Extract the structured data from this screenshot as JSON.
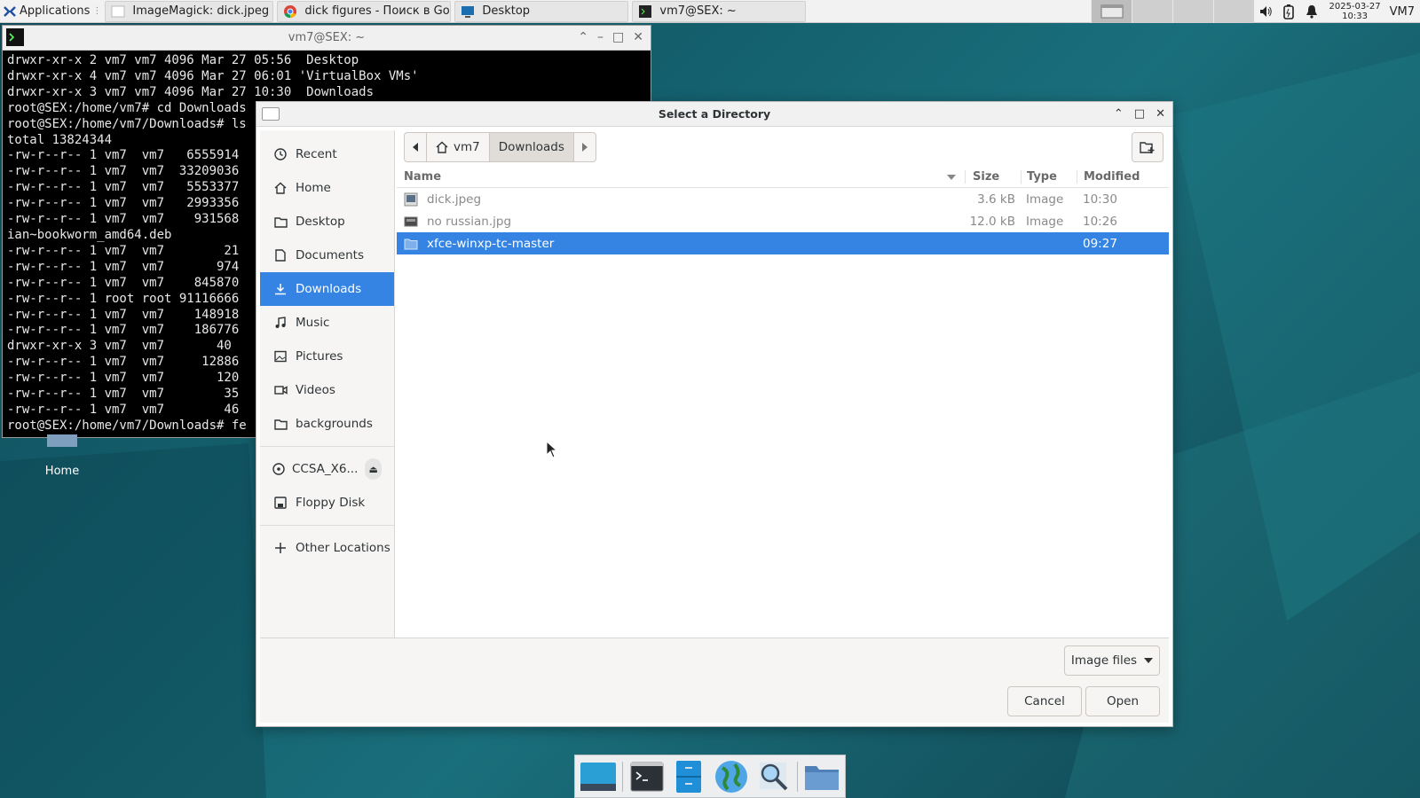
{
  "top_panel": {
    "applications_label": "Applications",
    "tasks": [
      {
        "label": "ImageMagick: dick.jpeg"
      },
      {
        "label": "dick figures - Поиск в Go..."
      },
      {
        "label": "Desktop"
      },
      {
        "label": "vm7@SEX: ~"
      }
    ],
    "clock_date": "2025-03-27",
    "clock_time": "10:33",
    "user": "VM7"
  },
  "terminal": {
    "title": "vm7@SEX: ~",
    "lines": [
      "drwxr-xr-x 2 vm7 vm7 4096 Mar 27 05:56  Desktop",
      "drwxr-xr-x 4 vm7 vm7 4096 Mar 27 06:01 'VirtualBox VMs'",
      "drwxr-xr-x 3 vm7 vm7 4096 Mar 27 10:30  Downloads",
      "root@SEX:/home/vm7# cd Downloads",
      "root@SEX:/home/vm7/Downloads# ls",
      "total 13824344",
      "-rw-r--r-- 1 vm7  vm7   6555914",
      "-rw-r--r-- 1 vm7  vm7  33209036",
      "-rw-r--r-- 1 vm7  vm7   5553377",
      "-rw-r--r-- 1 vm7  vm7   2993356",
      "-rw-r--r-- 1 vm7  vm7    931568",
      "ian~bookworm_amd64.deb",
      "-rw-r--r-- 1 vm7  vm7        21",
      "-rw-r--r-- 1 vm7  vm7       974",
      "-rw-r--r-- 1 vm7  vm7    845870",
      "-rw-r--r-- 1 root root 91116666",
      "-rw-r--r-- 1 vm7  vm7    148918",
      "-rw-r--r-- 1 vm7  vm7    186776",
      "drwxr-xr-x 3 vm7  vm7       40",
      "-rw-r--r-- 1 vm7  vm7     12886",
      "-rw-r--r-- 1 vm7  vm7       120",
      "-rw-r--r-- 1 vm7  vm7        35",
      "-rw-r--r-- 1 vm7  vm7        46",
      "root@SEX:/home/vm7/Downloads# fe"
    ]
  },
  "desktop_icons": {
    "home_label": "Home"
  },
  "dialog": {
    "title": "Select a Directory",
    "sidebar": {
      "items": [
        {
          "label": "Recent",
          "icon": "clock-icon"
        },
        {
          "label": "Home",
          "icon": "home-icon"
        },
        {
          "label": "Desktop",
          "icon": "folder-icon"
        },
        {
          "label": "Documents",
          "icon": "document-icon"
        },
        {
          "label": "Downloads",
          "icon": "download-icon"
        },
        {
          "label": "Music",
          "icon": "music-icon"
        },
        {
          "label": "Pictures",
          "icon": "picture-icon"
        },
        {
          "label": "Videos",
          "icon": "video-icon"
        },
        {
          "label": "backgrounds",
          "icon": "folder-icon"
        }
      ],
      "devices": [
        {
          "label": "CCSA_X6...",
          "icon": "disc-icon"
        },
        {
          "label": "Floppy Disk",
          "icon": "floppy-icon"
        }
      ],
      "other_locations": "Other Locations"
    },
    "pathbar": {
      "home": "vm7",
      "current": "Downloads"
    },
    "columns": {
      "name": "Name",
      "size": "Size",
      "type": "Type",
      "modified": "Modified"
    },
    "files": [
      {
        "name": "dick.jpeg",
        "size": "3.6 kB",
        "type": "Image",
        "modified": "10:30"
      },
      {
        "name": "no russian.jpg",
        "size": "12.0 kB",
        "type": "Image",
        "modified": "10:26"
      },
      {
        "name": "xfce-winxp-tc-master",
        "size": "",
        "type": "",
        "modified": "09:27"
      }
    ],
    "filter_label": "Image files",
    "cancel_label": "Cancel",
    "open_label": "Open",
    "accent": "#3584e4"
  }
}
